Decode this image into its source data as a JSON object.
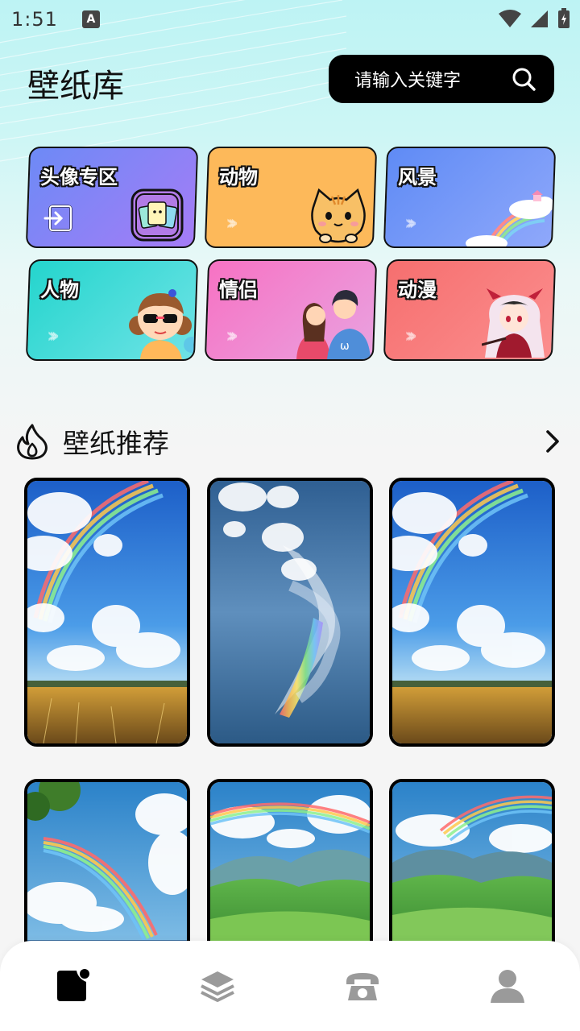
{
  "status": {
    "time": "1:51",
    "notif_letter": "A"
  },
  "header": {
    "title": "壁纸库",
    "search_placeholder": "请输入关键字"
  },
  "categories": [
    {
      "label": "头像专区",
      "color": "#8b7cf6"
    },
    {
      "label": "动物",
      "color": "#fdb95a"
    },
    {
      "label": "风景",
      "color": "#6f98f7"
    },
    {
      "label": "人物",
      "color": "#2ed3d0"
    },
    {
      "label": "情侣",
      "color": "#f17fc7"
    },
    {
      "label": "动漫",
      "color": "#f87878"
    }
  ],
  "section": {
    "title": "壁纸推荐"
  },
  "wallpapers": [
    {
      "name": "rainbow-field"
    },
    {
      "name": "rainbow-cloud"
    },
    {
      "name": "rainbow-field"
    },
    {
      "name": "rainbow-sky"
    },
    {
      "name": "rainbow-valley"
    },
    {
      "name": "rainbow-valley"
    }
  ],
  "tabs": [
    {
      "name": "home-tab",
      "icon": "wallpaper-icon",
      "active": true
    },
    {
      "name": "layers-tab",
      "icon": "layers-icon",
      "active": false
    },
    {
      "name": "phone-tab",
      "icon": "phone-icon",
      "active": false
    },
    {
      "name": "profile-tab",
      "icon": "user-icon",
      "active": false
    }
  ],
  "colors": {
    "accent": "#000000",
    "inactive": "#9a9a9a",
    "top_bg": "#bdf3f4"
  }
}
